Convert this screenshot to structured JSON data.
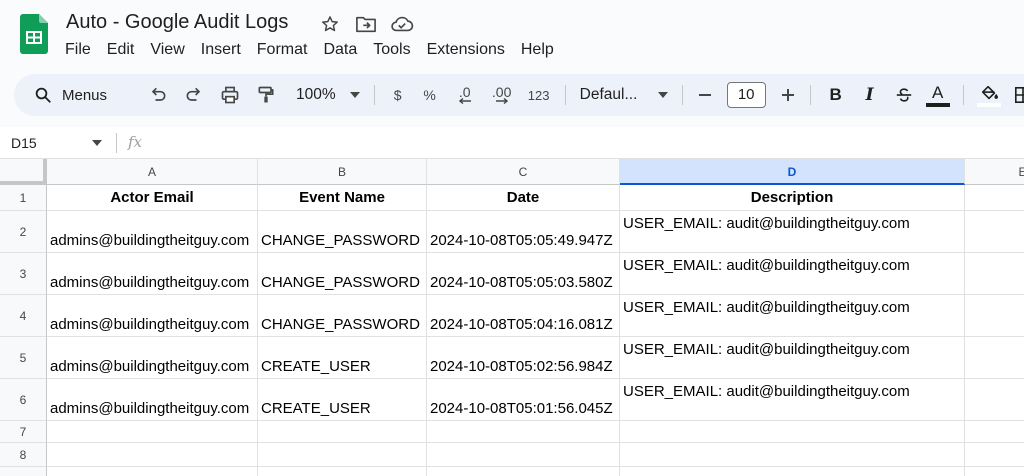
{
  "document": {
    "title": "Auto - Google Audit Logs"
  },
  "menu": [
    "File",
    "Edit",
    "View",
    "Insert",
    "Format",
    "Data",
    "Tools",
    "Extensions",
    "Help"
  ],
  "toolbar": {
    "search_label": "Menus",
    "zoom": "100%",
    "currency": "$",
    "percent": "%",
    "decrease_decimal": ".0",
    "increase_decimal": ".00",
    "number_format": "123",
    "font": "Defaul...",
    "font_size": "10",
    "bold": "B",
    "italic": "I",
    "text_color_letter": "A",
    "accent_color": "#1f1f1f"
  },
  "formula_bar": {
    "name_box": "D15",
    "fx_label": "fx"
  },
  "sheet": {
    "columns": [
      "A",
      "B",
      "C",
      "D",
      "E"
    ],
    "active_column": "D",
    "row_numbers": [
      "1",
      "2",
      "3",
      "4",
      "5",
      "6",
      "7",
      "8"
    ],
    "headers": [
      "Actor Email",
      "Event Name",
      "Date",
      "Description"
    ],
    "rows": [
      [
        "admins@buildingtheitguy.com",
        "CHANGE_PASSWORD",
        "2024-10-08T05:05:49.947Z",
        "USER_EMAIL: audit@buildingtheitguy.com"
      ],
      [
        "admins@buildingtheitguy.com",
        "CHANGE_PASSWORD",
        "2024-10-08T05:05:03.580Z",
        "USER_EMAIL: audit@buildingtheitguy.com"
      ],
      [
        "admins@buildingtheitguy.com",
        "CHANGE_PASSWORD",
        "2024-10-08T05:04:16.081Z",
        "USER_EMAIL: audit@buildingtheitguy.com"
      ],
      [
        "admins@buildingtheitguy.com",
        "CREATE_USER",
        "2024-10-08T05:02:56.984Z",
        "USER_EMAIL: audit@buildingtheitguy.com"
      ],
      [
        "admins@buildingtheitguy.com",
        "CREATE_USER",
        "2024-10-08T05:01:56.045Z",
        "USER_EMAIL: audit@buildingtheitguy.com"
      ]
    ]
  }
}
